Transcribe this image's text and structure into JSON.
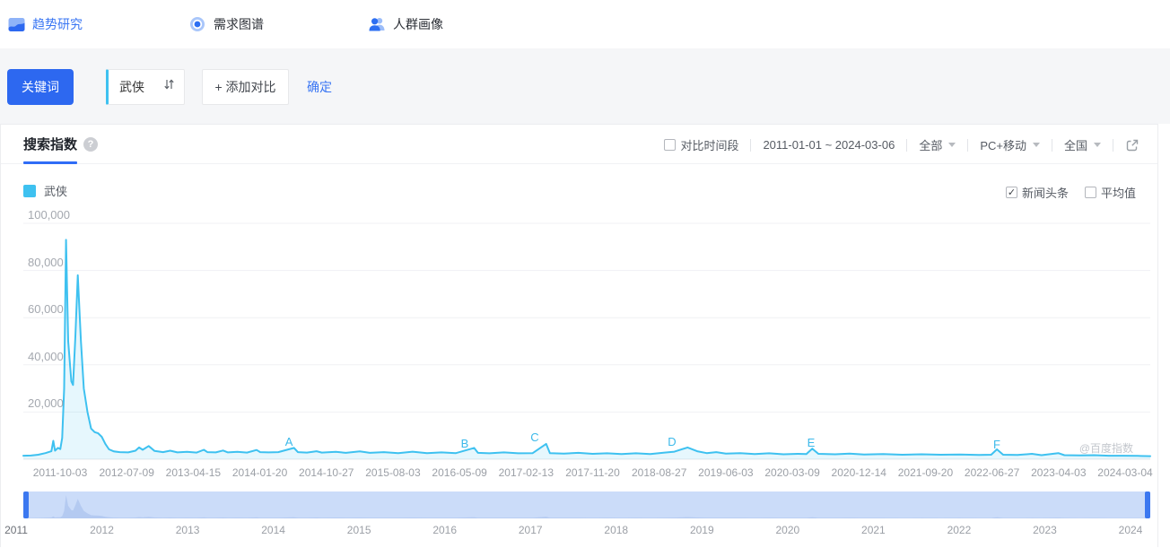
{
  "nav": {
    "items": [
      {
        "label": "趋势研究",
        "active": true
      },
      {
        "label": "需求图谱",
        "active": false
      },
      {
        "label": "人群画像",
        "active": false
      }
    ]
  },
  "keyword_bar": {
    "category_label": "关键词",
    "keyword": "武侠",
    "add_compare_label": "+ 添加对比",
    "confirm_label": "确定"
  },
  "panel": {
    "tab_label": "搜索指数",
    "controls": {
      "compare_label": "对比时间段",
      "compare_checked": false,
      "date_range": "2011-01-01 ~ 2024-03-06",
      "scope": "全部",
      "device": "PC+移动",
      "region": "全国"
    },
    "legend": {
      "series_label": "武侠",
      "news_label": "新闻头条",
      "news_checked": true,
      "average_label": "平均值",
      "average_checked": false
    },
    "watermark": "@百度指数"
  },
  "chart_data": {
    "type": "area",
    "series_name": "武侠",
    "x_range": [
      "2011-01-01",
      "2024-03-06"
    ],
    "ylim": [
      0,
      100000
    ],
    "grid": true,
    "line_color": "#3ec1f0",
    "fill_color": "rgba(62,193,240,0.13)",
    "y_tick_values": [
      20000,
      40000,
      60000,
      80000,
      100000
    ],
    "y_tick_labels": [
      "20,000",
      "40,000",
      "60,000",
      "80,000",
      "100,000"
    ],
    "x_tick_labels": [
      "2011-10-03",
      "2012-07-09",
      "2013-04-15",
      "2014-01-20",
      "2014-10-27",
      "2015-08-03",
      "2016-05-09",
      "2017-02-13",
      "2017-11-20",
      "2018-08-27",
      "2019-06-03",
      "2020-03-09",
      "2020-12-14",
      "2021-09-20",
      "2022-06-27",
      "2023-04-03",
      "2024-03-04"
    ],
    "event_markers": [
      {
        "label": "A",
        "x_frac": 0.2357,
        "y": 346
      },
      {
        "label": "B",
        "x_frac": 0.3917,
        "y": 348
      },
      {
        "label": "C",
        "x_frac": 0.4538,
        "y": 341
      },
      {
        "label": "D",
        "x_frac": 0.5756,
        "y": 346
      },
      {
        "label": "E",
        "x_frac": 0.699,
        "y": 347
      },
      {
        "label": "F",
        "x_frac": 0.8638,
        "y": 349
      }
    ],
    "points": [
      [
        0.0,
        1500
      ],
      [
        0.0068,
        1550
      ],
      [
        0.0132,
        1900
      ],
      [
        0.0196,
        2600
      ],
      [
        0.0249,
        3400
      ],
      [
        0.0266,
        7800
      ],
      [
        0.0281,
        3600
      ],
      [
        0.0307,
        4800
      ],
      [
        0.0328,
        4300
      ],
      [
        0.0345,
        9000
      ],
      [
        0.0362,
        30000
      ],
      [
        0.0379,
        93000
      ],
      [
        0.0398,
        50000
      ],
      [
        0.0426,
        33000
      ],
      [
        0.0441,
        31500
      ],
      [
        0.0462,
        52000
      ],
      [
        0.0483,
        78000
      ],
      [
        0.0511,
        50000
      ],
      [
        0.0537,
        30000
      ],
      [
        0.0569,
        20000
      ],
      [
        0.0601,
        13000
      ],
      [
        0.0633,
        11500
      ],
      [
        0.0664,
        11000
      ],
      [
        0.0696,
        9500
      ],
      [
        0.0728,
        6500
      ],
      [
        0.076,
        4200
      ],
      [
        0.0803,
        3300
      ],
      [
        0.0856,
        3000
      ],
      [
        0.0931,
        2900
      ],
      [
        0.0995,
        3600
      ],
      [
        0.1027,
        5000
      ],
      [
        0.1059,
        4000
      ],
      [
        0.1112,
        5600
      ],
      [
        0.1165,
        3500
      ],
      [
        0.124,
        3000
      ],
      [
        0.1303,
        3600
      ],
      [
        0.1367,
        2900
      ],
      [
        0.1453,
        3100
      ],
      [
        0.1538,
        2800
      ],
      [
        0.1602,
        4000
      ],
      [
        0.1633,
        3000
      ],
      [
        0.1708,
        2900
      ],
      [
        0.1772,
        3700
      ],
      [
        0.1815,
        2900
      ],
      [
        0.19,
        3100
      ],
      [
        0.1985,
        2800
      ],
      [
        0.207,
        3900
      ],
      [
        0.2102,
        3000
      ],
      [
        0.2177,
        2900
      ],
      [
        0.2262,
        3000
      ],
      [
        0.2402,
        4800
      ],
      [
        0.2436,
        3000
      ],
      [
        0.2517,
        2800
      ],
      [
        0.2602,
        3400
      ],
      [
        0.2649,
        2800
      ],
      [
        0.2773,
        3100
      ],
      [
        0.2862,
        2700
      ],
      [
        0.2986,
        3300
      ],
      [
        0.3075,
        2700
      ],
      [
        0.3199,
        3000
      ],
      [
        0.3327,
        2600
      ],
      [
        0.3454,
        3200
      ],
      [
        0.3582,
        2600
      ],
      [
        0.371,
        2900
      ],
      [
        0.3838,
        2600
      ],
      [
        0.4,
        4800
      ],
      [
        0.4034,
        2700
      ],
      [
        0.4136,
        2500
      ],
      [
        0.4264,
        2900
      ],
      [
        0.4392,
        2500
      ],
      [
        0.452,
        2600
      ],
      [
        0.4639,
        6500
      ],
      [
        0.4673,
        2600
      ],
      [
        0.4797,
        2400
      ],
      [
        0.4925,
        2700
      ],
      [
        0.5052,
        2300
      ],
      [
        0.518,
        2500
      ],
      [
        0.5308,
        2200
      ],
      [
        0.5436,
        2500
      ],
      [
        0.5563,
        2200
      ],
      [
        0.5691,
        2800
      ],
      [
        0.5777,
        3200
      ],
      [
        0.5894,
        5000
      ],
      [
        0.5979,
        3400
      ],
      [
        0.6064,
        2600
      ],
      [
        0.6149,
        3000
      ],
      [
        0.6234,
        2400
      ],
      [
        0.6362,
        2600
      ],
      [
        0.649,
        2200
      ],
      [
        0.6618,
        2500
      ],
      [
        0.6745,
        2100
      ],
      [
        0.6873,
        2300
      ],
      [
        0.6948,
        2200
      ],
      [
        0.7001,
        4500
      ],
      [
        0.7055,
        2300
      ],
      [
        0.7204,
        2100
      ],
      [
        0.7332,
        2400
      ],
      [
        0.746,
        2000
      ],
      [
        0.763,
        2200
      ],
      [
        0.78,
        1900
      ],
      [
        0.7971,
        2100
      ],
      [
        0.8141,
        1900
      ],
      [
        0.8311,
        2000
      ],
      [
        0.8482,
        1800
      ],
      [
        0.8588,
        1900
      ],
      [
        0.8639,
        4200
      ],
      [
        0.8694,
        1900
      ],
      [
        0.8822,
        1800
      ],
      [
        0.895,
        2300
      ],
      [
        0.9035,
        1700
      ],
      [
        0.9184,
        2600
      ],
      [
        0.9238,
        1700
      ],
      [
        0.9376,
        1600
      ],
      [
        0.9504,
        1700
      ],
      [
        0.9631,
        1500
      ],
      [
        0.9759,
        1500
      ],
      [
        0.9887,
        1400
      ],
      [
        1.0,
        1300
      ]
    ]
  },
  "slider": {
    "years": [
      "2011",
      "2012",
      "2013",
      "2014",
      "2015",
      "2016",
      "2017",
      "2018",
      "2019",
      "2020",
      "2021",
      "2022",
      "2023",
      "2024"
    ]
  }
}
